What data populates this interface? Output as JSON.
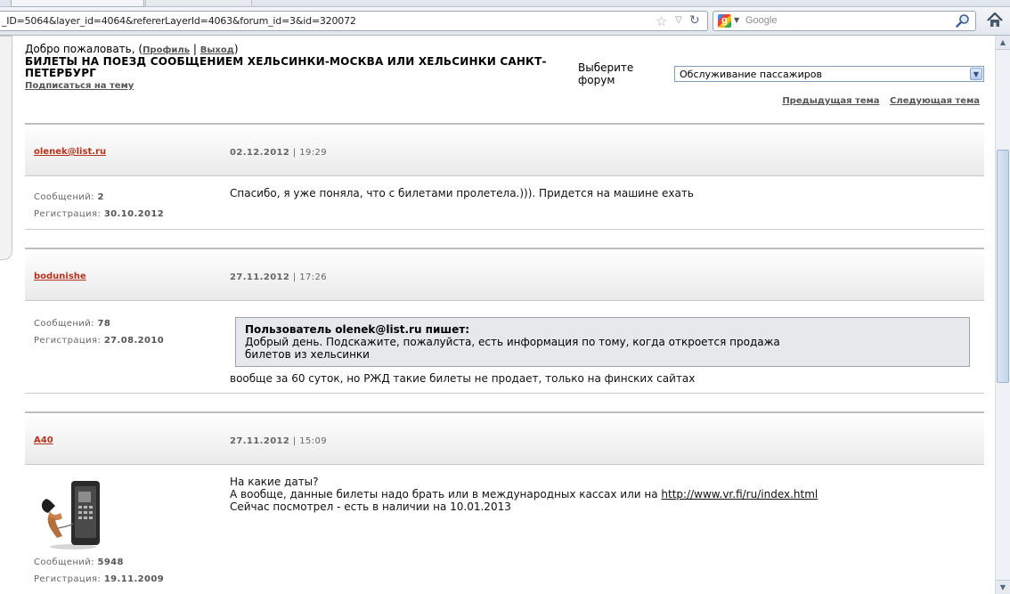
{
  "browser": {
    "url": "_ID=5064&layer_id=4064&refererLayerId=4063&forum_id=3&id=320072",
    "search_placeholder": "Google",
    "search_engine_letter": "g"
  },
  "header": {
    "welcome_prefix": "Добро пожаловать, (",
    "profile_link": "Профиль",
    "separator": "|",
    "logout_link": "Выход",
    "welcome_suffix": ")",
    "topic_title": "БИЛЕТЫ НА ПОЕЗД СООБЩЕНИЕМ ХЕЛЬСИНКИ-МОСКВА ИЛИ ХЕЛЬСИНКИ САНКТ-ПЕТЕРБУРГ",
    "subscribe_link": "Подписаться на тему",
    "forum_label": "Выберите форум",
    "forum_selected": "Обслуживание пассажиров",
    "prev_topic": "Предыдущая тема",
    "next_topic": "Следующая тема"
  },
  "stats_labels": {
    "messages": "Сообщений:",
    "registration": "Регистрация:"
  },
  "posts": [
    {
      "author": "olenek@list.ru",
      "date": "02.12.2012",
      "time": "19:29",
      "messages": "2",
      "registered": "30.10.2012",
      "text": "Спасибо, я уже поняла, что с билетами пролетела.))). Придется на машине ехать"
    },
    {
      "author": "bodunishe",
      "date": "27.11.2012",
      "time": "17:26",
      "messages": "78",
      "registered": "27.08.2010",
      "quote_header": "Пользователь olenek@list.ru пишет:",
      "quote_line1": "Добрый день. Подскажите, пожалуйста, есть информация по тому, когда откроется продажа",
      "quote_line2": "билетов из хельсинки",
      "text": "вообще за 60 суток, но РЖД такие билеты не продает, только на финских сайтах"
    },
    {
      "author": "A40",
      "date": "27.11.2012",
      "time": "15:09",
      "messages": "5948",
      "registered": "19.11.2009",
      "line1": "На какие даты?",
      "line2_prefix": "А вообще, данные билеты надо брать или в международных кассах или на ",
      "link": "http://www.vr.fi/ru/index.html",
      "line3": "Сейчас посмотрел - есть в наличии на 10.01.2013"
    }
  ]
}
